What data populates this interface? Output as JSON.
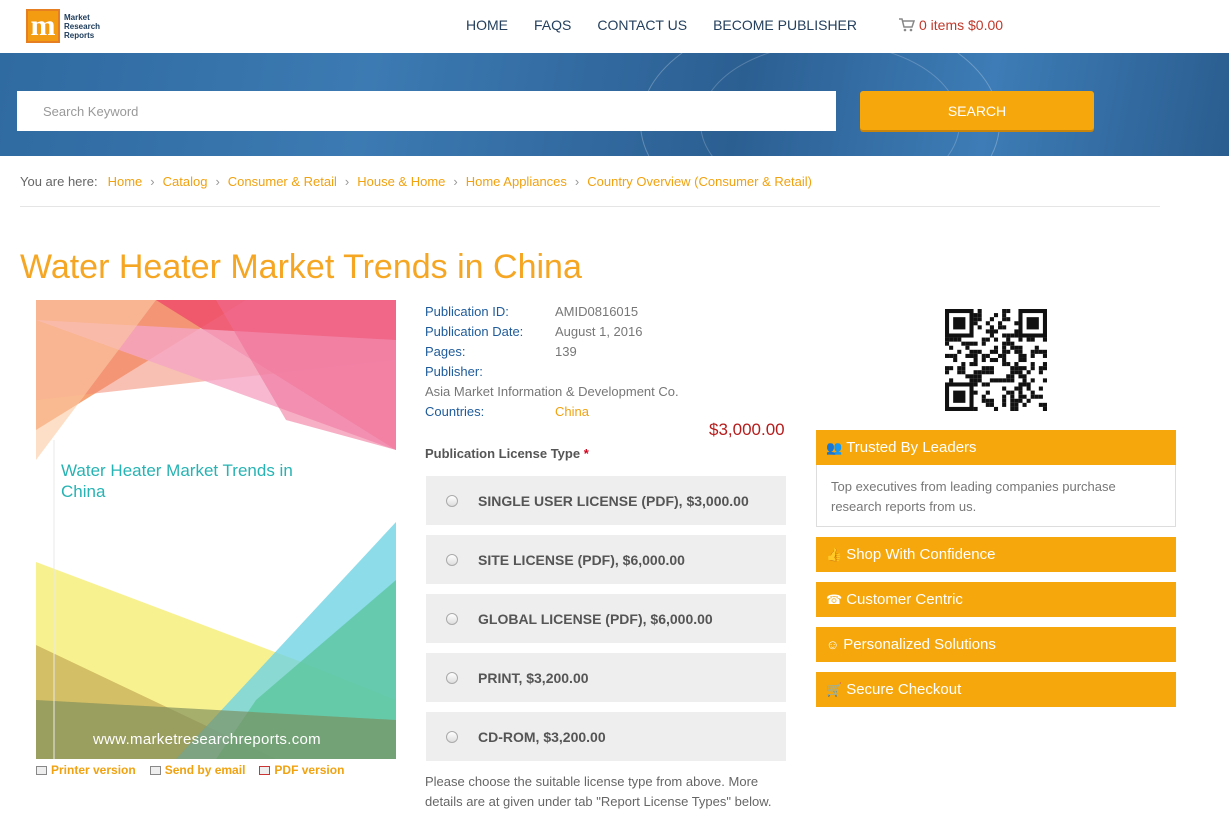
{
  "header": {
    "logo_line1": "Market",
    "logo_line2": "Research",
    "logo_line3": "Reports",
    "nav": [
      "HOME",
      "FAQS",
      "CONTACT US",
      "BECOME PUBLISHER"
    ],
    "cart": "0 items $0.00"
  },
  "search": {
    "placeholder": "Search Keyword",
    "button": "SEARCH"
  },
  "breadcrumb": {
    "prefix": "You are here:",
    "items": [
      "Home",
      "Catalog",
      "Consumer & Retail",
      "House & Home",
      "Home Appliances",
      "Country Overview (Consumer & Retail)"
    ]
  },
  "title": "Water Heater Market Trends in China",
  "cover": {
    "title": "Water Heater Market Trends in China",
    "url": "www.marketresearchreports.com"
  },
  "cover_links": [
    "Printer version",
    "Send by email",
    "PDF version"
  ],
  "details": {
    "publication_id_label": "Publication ID:",
    "publication_id": "AMID0816015",
    "publication_date_label": "Publication Date:",
    "publication_date": "August 1, 2016",
    "pages_label": "Pages:",
    "pages": "139",
    "publisher_label": "Publisher:",
    "publisher": "Asia Market Information & Development Co.",
    "countries_label": "Countries:",
    "countries": "China"
  },
  "price": "$3,000.00",
  "license_title": "Publication License Type",
  "license_required": "*",
  "licenses": [
    "SINGLE USER LICENSE (PDF), $3,000.00",
    "SITE LICENSE (PDF), $6,000.00",
    "GLOBAL LICENSE (PDF), $6,000.00",
    "PRINT, $3,200.00",
    "CD-ROM, $3,200.00"
  ],
  "note": "Please choose the suitable license type from above. More details are at given under tab \"Report License Types\" below.",
  "panels": {
    "trusted": "Trusted By Leaders",
    "trusted_body": "Top executives from leading companies purchase research reports from us.",
    "shop": "Shop With Confidence",
    "customer": "Customer Centric",
    "personalized": "Personalized Solutions",
    "secure": "Secure Checkout"
  },
  "colors": {
    "accent": "#f6a70c",
    "title": "#f5a623",
    "link": "#f0a210",
    "label_blue": "#1f5b9a",
    "price": "#b71c1c"
  }
}
